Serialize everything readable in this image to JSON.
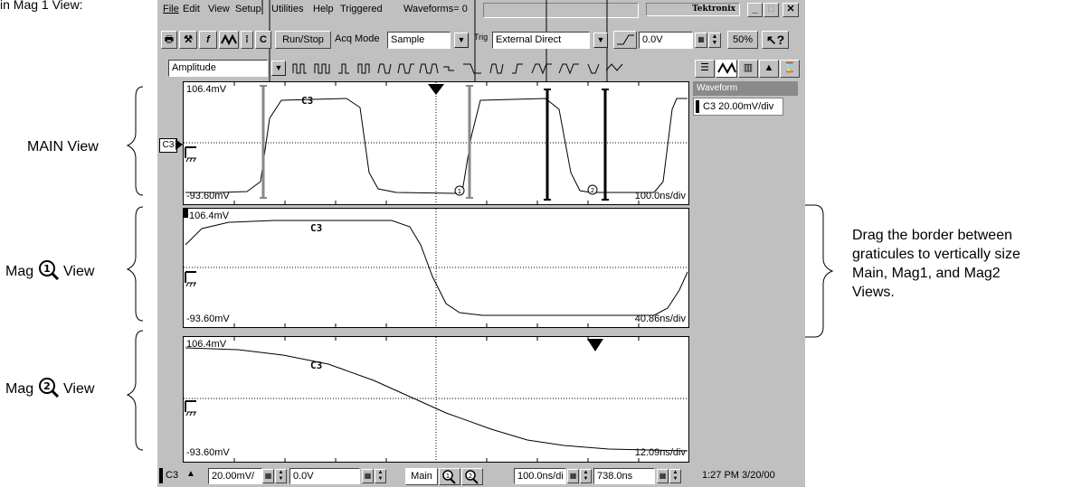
{
  "annotations": {
    "top_left": "in Mag 1 View:",
    "main_view": "MAIN View",
    "mag1_view_prefix": "Mag",
    "mag1_view_suffix": "View",
    "mag2_view_prefix": "Mag",
    "mag2_view_suffix": "View",
    "right_note_lines": [
      "Drag the border between",
      "graticules to vertically size",
      "Main, Mag1, and Mag2",
      "Views."
    ]
  },
  "menubar": {
    "items": [
      "File",
      "Edit",
      "View",
      "Setup",
      "Utilities",
      "Help"
    ],
    "status_triggered": "Triggered",
    "status_waveforms": "Waveforms= 0",
    "brand": "Tektronix"
  },
  "toolbar": {
    "c_label": "C",
    "runstop_label": "Run/Stop",
    "acq_mode_label": "Acq Mode",
    "acq_mode_value": "Sample",
    "trig_label": "Trig",
    "trig_source_value": "External Direct",
    "trig_level_value": "0.0V",
    "zoom_value": "50%"
  },
  "measure": {
    "select_value": "Amplitude"
  },
  "right_panel": {
    "waveform_tab": "Waveform",
    "waveform_entry": "C3 20.00mV/div"
  },
  "channel_marker": "C3",
  "views": {
    "main": {
      "top_label": "106.4mV",
      "bottom_label": "-93.60mV",
      "scale": "100.0ns/div",
      "trace": "C3"
    },
    "mag1": {
      "top_label": "106.4mV",
      "bottom_label": "-93.60mV",
      "scale": "40.86ns/div",
      "trace": "C3"
    },
    "mag2": {
      "top_label": "106.4mV",
      "bottom_label": "-93.60mV",
      "scale": "12.09ns/div",
      "trace": "C3"
    }
  },
  "bottom_bar": {
    "channel": "C3",
    "vscale_value": "20.00mV/",
    "offset_value": "0.0V",
    "main_label": "Main",
    "hscale_value": "100.0ns/di",
    "delay_value": "738.0ns",
    "clock": "1:27 PM 3/20/00"
  },
  "colors": {
    "window_bg": "#c0c0c0",
    "graticule_bg": "#ffffff",
    "tab_bg": "#8a8a8a"
  },
  "icons": [
    "print-icon",
    "tools-icon",
    "function-icon",
    "waveform-icon",
    "cursor-icon",
    "help-icon",
    "mag1-icon",
    "mag2-icon"
  ]
}
